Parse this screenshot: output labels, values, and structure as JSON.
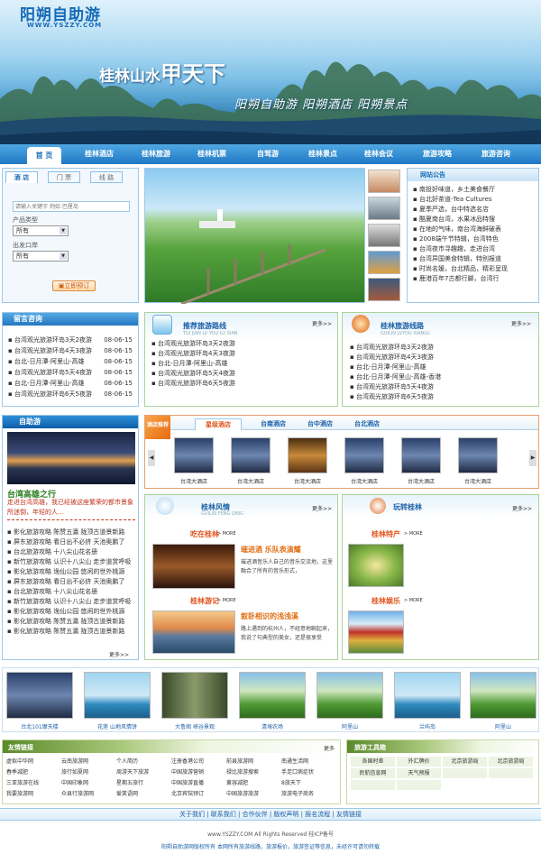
{
  "header": {
    "logo_title": "阳朔自助游",
    "logo_url": "WWW.YSZZY.COM",
    "slogan": "桂林山水",
    "slogan_big": "甲天下",
    "sub_slogan": "阳朔自助游  阳朔酒店  阳朔景点"
  },
  "nav": [
    "首 页",
    "桂林酒店",
    "桂林旅游",
    "桂林机票",
    "自驾游",
    "桂林景点",
    "桂林会议",
    "旅游攻略",
    "旅游咨询"
  ],
  "search": {
    "tabs": [
      "酒 店",
      "门 票",
      "线 路"
    ],
    "placeholder": "请输入关键字 例如 巴厘岛",
    "type_label": "产品类型",
    "type_value": "所有",
    "city_label": "出发口岸",
    "city_value": "所有",
    "submit": "立即预订"
  },
  "notice": {
    "title": "网站公告",
    "items": [
      "南投好味道，乡土美食餐厅",
      "台北好茶道-Tea Cultures",
      "夏季严选，台中特选名店",
      "酷夏南台湾，水果冰品特搜",
      "在地的气味，南台湾海鲜破表",
      "2008端午节特辑，台湾特色",
      "台湾夜市寻趣趣，走进台湾",
      "台湾异国美食特辑，特别报道",
      "时尚名媛，台北精品，精彩呈现",
      "鹿港百年7古都行脚，台湾行"
    ]
  },
  "consult": {
    "title": "留言咨询",
    "items": [
      {
        "text": "台湾观光旅游环岛3天2夜游",
        "date": "08-06-15"
      },
      {
        "text": "台湾观光旅游环岛4天3夜游",
        "date": "08-06-15"
      },
      {
        "text": "台北-日月潭-阿里山-高雄",
        "date": "08-06-15"
      },
      {
        "text": "台湾观光旅游环岛5天4夜游",
        "date": "08-06-15"
      },
      {
        "text": "台北-日月潭-阿里山-高雄",
        "date": "08-06-15"
      },
      {
        "text": "台湾观光旅游环岛6天5夜游",
        "date": "08-06-15"
      }
    ]
  },
  "recommend": {
    "title": "推荐旅游路线",
    "subtitle": "TUI JIAN LV YOU LU XIAN",
    "more": "更多>>",
    "items": [
      "台湾观光旅游环岛3天2夜游",
      "台湾观光旅游环岛4天3夜游",
      "台北-日月潭-阿里山-高雄",
      "台湾观光旅游环岛5天4夜游",
      "台湾观光旅游环岛6天5夜游"
    ]
  },
  "guilin_line": {
    "title": "桂林旅游线路",
    "subtitle": "GUILIN LVYOU XIANLU",
    "more": "更多>>",
    "items": [
      "台湾观光旅游环岛3天2夜游",
      "台湾观光旅游环岛4天3夜游",
      "台北-日月潭-阿里山-高雄",
      "台北-日月潭-阿里山-高雄-香港",
      "台湾观光旅游环岛5天4夜游",
      "台湾观光旅游环岛6天5夜游"
    ]
  },
  "selfguide": {
    "title": "自助游",
    "headline": "台湾高雄之行",
    "desc": "走进台湾高雄，我已经被这座繁荣的都市景象所迷倒，年轻的人...",
    "items": [
      "影化旅游攻略 陈赞五瀛 陇顶古道景新路",
      "屏东旅游攻略 看日出不必挤 天池奥鹏了",
      "台北旅游攻略 十八尖山花名册",
      "新竹旅游攻略 认识十八尖山 走步道赏呼吸",
      "影化旅游攻略 逸仙公园 悠闲的世外桃源",
      "屏东旅游攻略 看日出不必挤 天池奥鹏了",
      "台北旅游攻略 十八尖山花名册",
      "新竹旅游攻略 认识十八尖山 走步道赏呼吸",
      "影化旅游攻略 逸仙公园 悠闲的世外桃源",
      "影化旅游攻略 陈赞五瀛 陇顶古道景新路",
      "影化旅游攻略 陈赞五瀛 陇顶古道景新路"
    ],
    "more": "更多>>"
  },
  "hotels": {
    "badge": "酒店推荐",
    "tabs": [
      "星级酒店",
      "台南酒店",
      "台中酒店",
      "台北酒店"
    ],
    "items": [
      "台湾大酒店",
      "台湾大酒店",
      "台湾大酒店",
      "台湾大酒店",
      "台湾大酒店",
      "台湾大酒店"
    ]
  },
  "fengqing": {
    "title": "桂林风情",
    "subtitle": "GUILIN FENG QING",
    "more": "更多>>",
    "eat_title": "吃在桂林",
    "eat_more": "> MORE",
    "eat_headline": "璀进酒 乐队表演耀",
    "eat_desc": "璀进酒音乐人自己的音乐交流地，这里融合了所有的音乐形式，",
    "trip_title": "桂林游记",
    "trip_more": "> MORE",
    "trip_headline": "叙卧相识的浅浅溪",
    "trip_desc": "路上遇到的杭州人，不经意地聊起来，我说了句典型的美女，还是很享受"
  },
  "wanzhuan": {
    "title": "玩转桂林",
    "more": "更多>>",
    "specialty_title": "桂林特产",
    "specialty_more": "> MORE",
    "fun_title": "桂林娱乐",
    "fun_more": "> MORE"
  },
  "photos": [
    "台北101摩天楼",
    "花莲 山地风情饼",
    "大鲁阁 峡谷景观",
    "清境农场",
    "阿里山",
    "兰屿岛",
    "阿里山"
  ],
  "links": {
    "title": "友情链接",
    "more": "更多",
    "items": [
      "虚拟中华网",
      "云南旅游网",
      "个人简历",
      "注册香港公司",
      "前县旅游网",
      "南通生活网",
      "春季减肥",
      "旅行如夏网",
      "周游天下旅游",
      "中国旅游营销",
      "禄比旅游搜索",
      "手足口病症状",
      "三亚旅游在线",
      "中国印象网",
      "星期五旅行",
      "中国旅游直播",
      "黄容减肥",
      "8旅天下",
      "我要旅游网",
      "众县行旅游网",
      "爱笑语网",
      "北京宾馆预订",
      "中国旅游旅游",
      "旅游电子商务"
    ]
  },
  "tools": {
    "title": "旅游工具箱",
    "items": [
      "各国时差",
      "外汇牌价",
      "北京旅游局",
      "北京旅游局",
      "民航信息网",
      "天气预报",
      "",
      "",
      "",
      ""
    ]
  },
  "footer": {
    "links": [
      "关于我们",
      "联系我们",
      "合作伙伴",
      "版权声明",
      "报名流程",
      "友情链接"
    ],
    "copyright": "www.YSZZY.COM All Rights Reserved 桂ICP备号",
    "note": "阳朔自助游网版权所有 本网所有旅游线路，旅游报价，旅游签证等信息，未经许可请勿转载"
  }
}
